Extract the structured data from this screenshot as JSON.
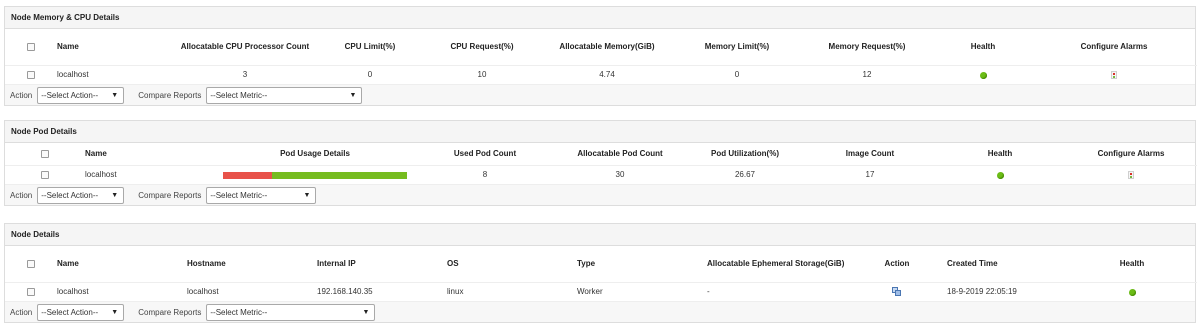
{
  "cpu_panel": {
    "title": "Node Memory & CPU Details",
    "headers": [
      "Name",
      "Allocatable CPU Processor Count",
      "CPU Limit(%)",
      "CPU Request(%)",
      "Allocatable Memory(GiB)",
      "Memory Limit(%)",
      "Memory Request(%)",
      "Health",
      "Configure Alarms"
    ],
    "row": {
      "name": "localhost",
      "cpu_count": "3",
      "cpu_limit": "0",
      "cpu_request": "10",
      "memory": "4.74",
      "memory_limit": "0",
      "memory_request": "12",
      "health": "green"
    }
  },
  "pod_panel": {
    "title": "Node Pod Details",
    "headers": [
      "Name",
      "Pod Usage Details",
      "Used Pod Count",
      "Allocatable Pod Count",
      "Pod Utilization(%)",
      "Image Count",
      "Health",
      "Configure Alarms"
    ],
    "row": {
      "name": "localhost",
      "used": "8",
      "allocatable": "30",
      "utilization": "26.67",
      "images": "17",
      "health": "green"
    },
    "usage_bar": {
      "used_fraction": 0.2667,
      "used_color": "#e8524a",
      "free_color": "#76bc1f"
    }
  },
  "node_panel": {
    "title": "Node Details",
    "headers": [
      "Name",
      "Hostname",
      "Internal IP",
      "OS",
      "Type",
      "Allocatable Ephemeral Storage(GiB)",
      "Action",
      "Created Time",
      "Health"
    ],
    "row": {
      "name": "localhost",
      "hostname": "localhost",
      "ip": "192.168.140.35",
      "os": "linux",
      "type": "Worker",
      "storage": "-",
      "action_icon": "settings-icon",
      "created": "18-9-2019 22:05:19",
      "health": "green"
    }
  },
  "footer": {
    "action_label": "Action",
    "action_select": "--Select Action--",
    "compare_label": "Compare Reports",
    "metric_select": "--Select Metric--"
  },
  "colors": {
    "health_green": "#6cbd16"
  }
}
